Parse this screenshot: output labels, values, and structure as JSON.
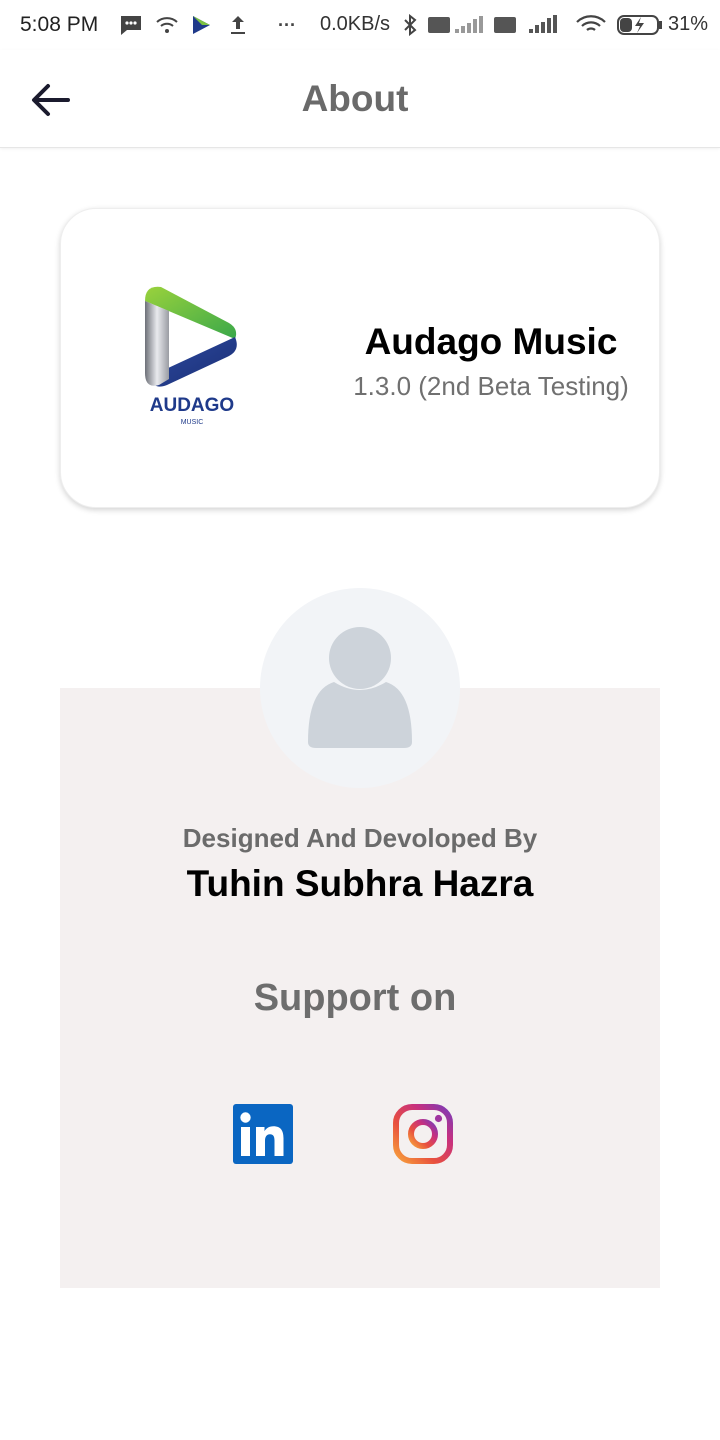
{
  "status_bar": {
    "time": "5:08 PM",
    "network_speed": "0.0KB/s",
    "battery_percent": "31%",
    "icons": [
      "message-icon",
      "wifi-icon",
      "audago-icon",
      "upload-icon",
      "more-dots-icon",
      "bluetooth-icon",
      "volte-signal-icon",
      "volte-4g-signal-icon",
      "wifi-icon",
      "battery-charging-icon"
    ]
  },
  "app_bar": {
    "title": "About",
    "back_icon": "arrow-back-icon"
  },
  "app_card": {
    "logo_text": "AUDAGO",
    "logo_subtext": "MUSIC",
    "app_name": "Audago Music",
    "version": "1.3.0  (2nd Beta Testing)"
  },
  "developer": {
    "caption": "Designed And Devoloped By",
    "name": "Tuhin Subhra Hazra",
    "avatar_icon": "person-icon"
  },
  "support": {
    "title": "Support on",
    "links": [
      {
        "icon": "linkedin-icon"
      },
      {
        "icon": "instagram-icon"
      }
    ]
  },
  "colors": {
    "title_gray": "#6a6a6a",
    "panel_bg": "#f4f0f0",
    "avatar_bg": "#f2f4f7",
    "linkedin_blue": "#0a66c2"
  }
}
